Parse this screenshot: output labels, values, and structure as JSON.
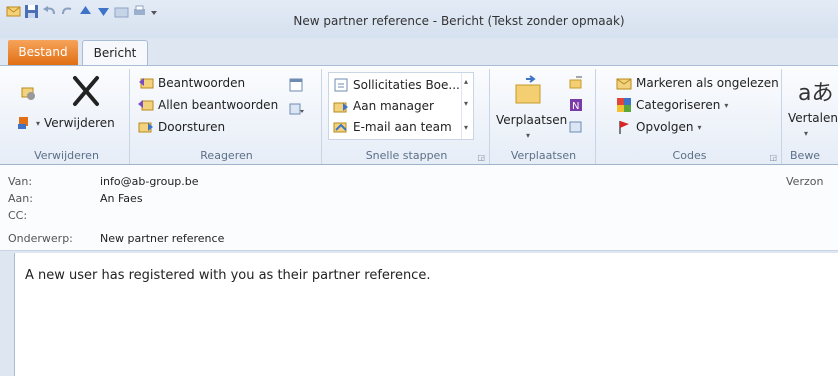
{
  "window": {
    "title": "New partner reference - Bericht (Tekst zonder opmaak)"
  },
  "tabs": {
    "file": "Bestand",
    "message": "Bericht"
  },
  "ribbon": {
    "delete_group": {
      "label": "Verwijderen",
      "delete_button": "Verwijderen"
    },
    "respond_group": {
      "label": "Reageren",
      "reply": "Beantwoorden",
      "reply_all": "Allen beantwoorden",
      "forward": "Doorsturen"
    },
    "quick_steps_group": {
      "label": "Snelle stappen",
      "items": [
        "Sollicitaties Boe...",
        "Aan manager",
        "E-mail aan team"
      ]
    },
    "move_group": {
      "label": "Verplaatsen",
      "move_button": "Verplaatsen"
    },
    "tags_group": {
      "label": "Codes",
      "mark_unread": "Markeren als ongelezen",
      "categorize": "Categoriseren",
      "follow_up": "Opvolgen"
    },
    "editing_group": {
      "label": "Bewe",
      "translate": "Vertalen",
      "translate_glyph": "aあ"
    }
  },
  "header": {
    "from_label": "Van:",
    "from_value": "info@ab-group.be",
    "to_label": "Aan:",
    "to_value": "An Faes",
    "cc_label": "CC:",
    "cc_value": "",
    "subject_label": "Onderwerp:",
    "subject_value": "New partner reference",
    "sent_label": "Verzon"
  },
  "message": {
    "body": "A new user has registered with you as their partner reference."
  },
  "colors": {
    "file_tab": "#e16f13",
    "ribbon_bg": "#e6edf7",
    "window_bg": "#dde6f1"
  }
}
